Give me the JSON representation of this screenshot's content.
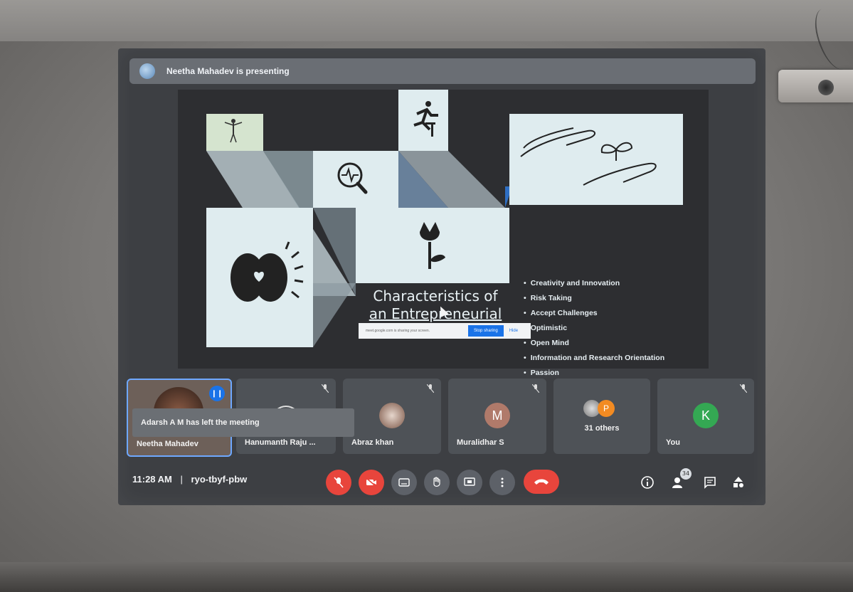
{
  "presenter": {
    "text": "Neetha Mahadev is presenting"
  },
  "slide": {
    "title_line1": "Characteristics of",
    "title_line2": "an Entrepreneurial",
    "bullets": [
      "Creativity and Innovation",
      "Risk Taking",
      "Accept Challenges",
      "Optimistic",
      "Open Mind",
      "Information and Research Orientation",
      "Passion"
    ],
    "share_bar": {
      "message": "meet.google.com is sharing your screen.",
      "stop_label": "Stop sharing",
      "hide_label": "Hide"
    }
  },
  "participants": [
    {
      "name": "Neetha Mahadev",
      "speaking": true
    },
    {
      "name": "Hanumanth Raju ...",
      "muted": true
    },
    {
      "name": "Abraz khan",
      "muted": true
    },
    {
      "name": "Muralidhar S",
      "initial": "M",
      "muted": true
    },
    {
      "name": "31 others",
      "initial": "P"
    },
    {
      "name": "You",
      "initial": "K",
      "muted": true
    }
  ],
  "toast": {
    "text": "Adarsh A M has left the meeting"
  },
  "meeting": {
    "time": "11:28 AM",
    "separator": "|",
    "code": "ryo-tbyf-pbw"
  },
  "people_count": "34",
  "colors": {
    "accent": "#1a73e8",
    "danger": "#e8453c",
    "avatar_m": "#b07a6a",
    "avatar_p": "#f28b22",
    "avatar_k": "#34a853"
  },
  "icons": {
    "controls": [
      "mic-off-icon",
      "camera-off-icon",
      "captions-icon",
      "raise-hand-icon",
      "present-screen-icon",
      "more-options-icon",
      "hang-up-icon"
    ],
    "right": [
      "info-icon",
      "people-icon",
      "chat-icon",
      "activities-icon"
    ]
  }
}
